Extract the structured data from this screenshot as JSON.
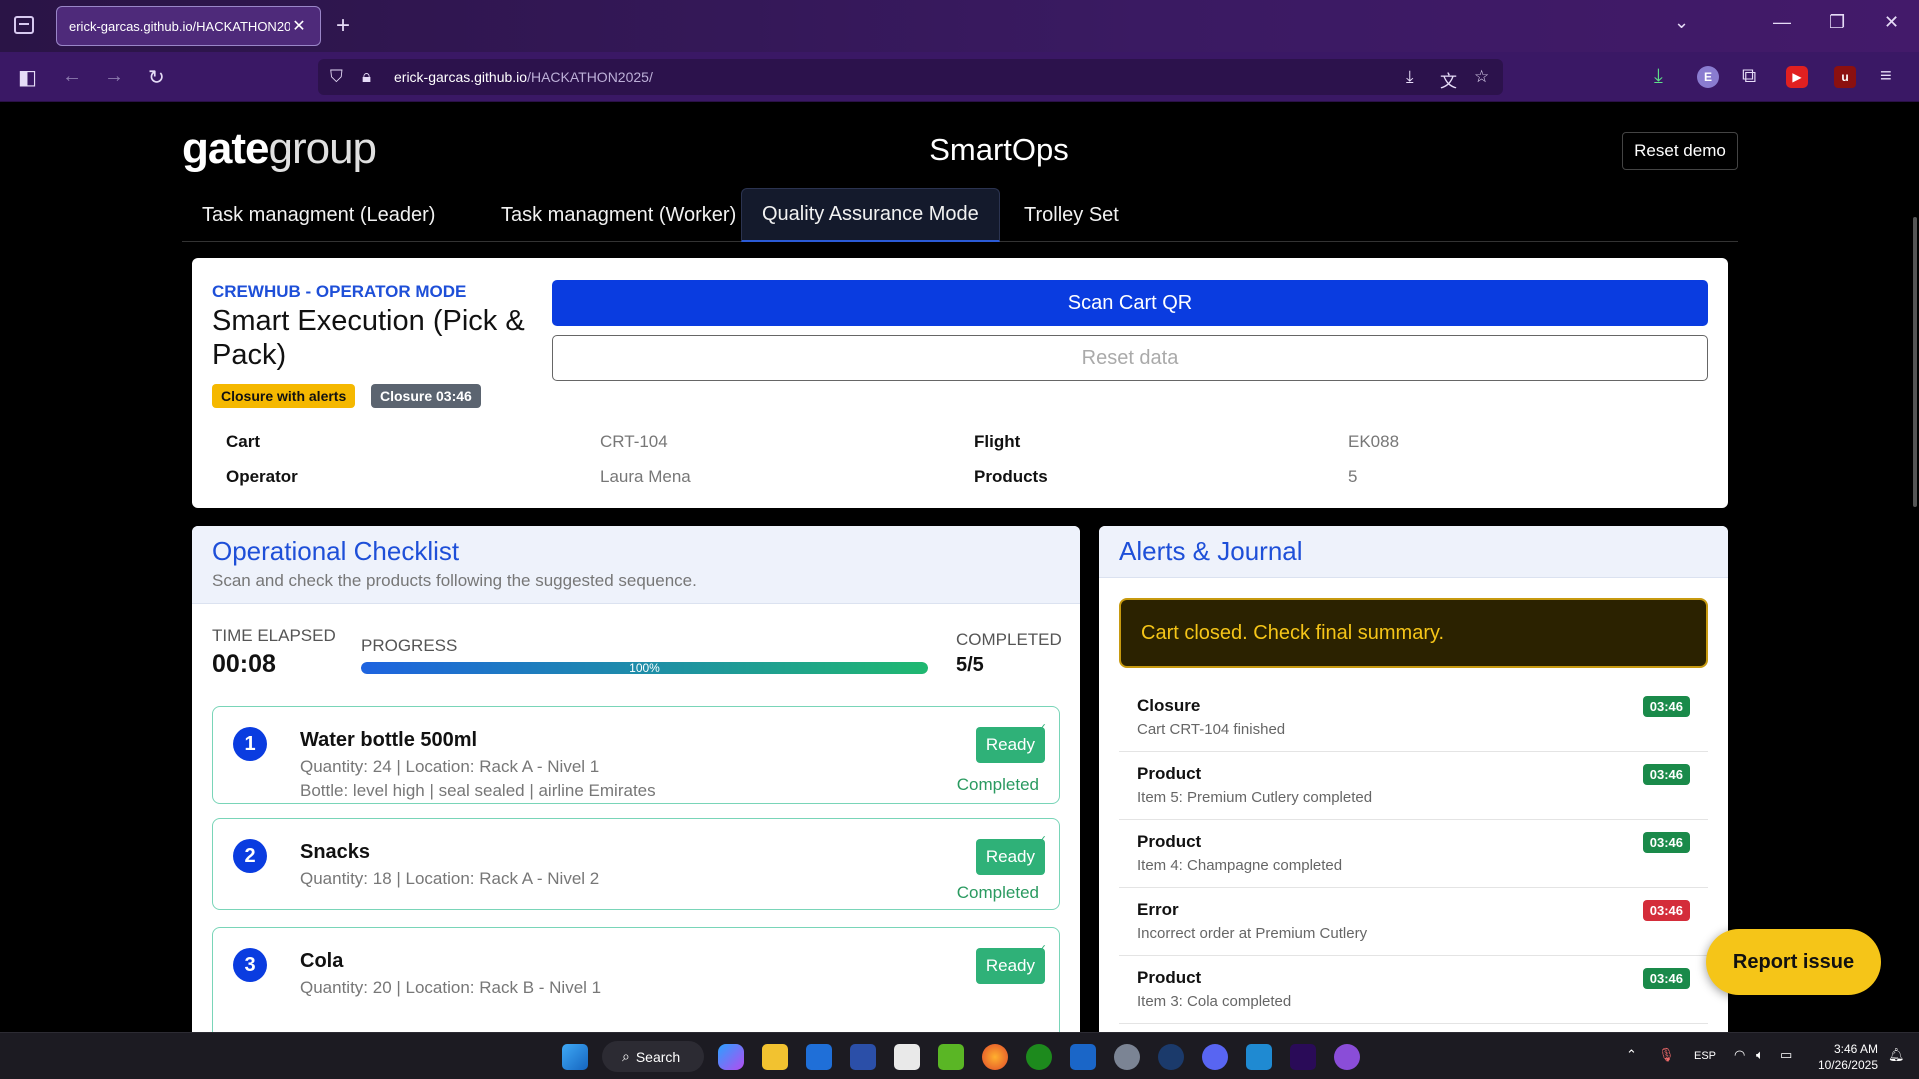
{
  "browser": {
    "tab_title": "erick-garcas.github.io/HACKATHON2025/",
    "url_host": "erick-garcas.github.io",
    "url_path": "/HACKATHON2025/"
  },
  "header": {
    "logo_bold": "gate",
    "logo_light": "group",
    "app_title": "SmartOps",
    "reset_demo": "Reset demo"
  },
  "nav_tabs": [
    {
      "label": "Task managment (Leader)"
    },
    {
      "label": "Task managment (Worker)"
    },
    {
      "label": "Quality Assurance Mode"
    },
    {
      "label": "Trolley Set"
    }
  ],
  "operator": {
    "mode_label": "CREWHUB - OPERATOR MODE",
    "title": "Smart Execution (Pick & Pack)",
    "badge_alerts": "Closure with alerts",
    "badge_closure": "Closure 03:46",
    "scan_button": "Scan Cart QR",
    "reset_button": "Reset data",
    "info": {
      "cart_label": "Cart",
      "cart_value": "CRT-104",
      "flight_label": "Flight",
      "flight_value": "EK088",
      "operator_label": "Operator",
      "operator_value": "Laura Mena",
      "products_label": "Products",
      "products_value": "5"
    }
  },
  "checklist": {
    "title": "Operational Checklist",
    "subtitle": "Scan and check the products following the suggested sequence.",
    "time_label": "TIME ELAPSED",
    "time_value": "00:08",
    "progress_label": "PROGRESS",
    "progress_text": "100%",
    "progress_value": 100,
    "completed_label": "COMPLETED",
    "completed_value": "5/5",
    "items": [
      {
        "num": "1",
        "name": "Water bottle 500ml",
        "meta1": "Quantity: 24 | Location: Rack A - Nivel 1",
        "meta2": "Bottle: level high | seal sealed | airline Emirates",
        "status": "Ready",
        "state": "Completed"
      },
      {
        "num": "2",
        "name": "Snacks",
        "meta1": "Quantity: 18 | Location: Rack A - Nivel 2",
        "status": "Ready",
        "state": "Completed"
      },
      {
        "num": "3",
        "name": "Cola",
        "meta1": "Quantity: 20 | Location: Rack B - Nivel 1",
        "status": "Ready"
      }
    ]
  },
  "alerts": {
    "title": "Alerts & Journal",
    "banner": "Cart closed. Check final summary.",
    "journal": [
      {
        "title": "Closure",
        "desc": "Cart CRT-104 finished",
        "time": "03:46",
        "kind": "ok"
      },
      {
        "title": "Product",
        "desc": "Item 5: Premium Cutlery completed",
        "time": "03:46",
        "kind": "ok"
      },
      {
        "title": "Product",
        "desc": "Item 4: Champagne completed",
        "time": "03:46",
        "kind": "ok"
      },
      {
        "title": "Error",
        "desc": "Incorrect order at Premium Cutlery",
        "time": "03:46",
        "kind": "err"
      },
      {
        "title": "Product",
        "desc": "Item 3: Cola completed",
        "time": "03:46",
        "kind": "ok"
      }
    ]
  },
  "report_button": "Report issue",
  "taskbar": {
    "search": "Search",
    "lang": "ESP",
    "time": "3:46 AM",
    "date": "10/26/2025"
  }
}
